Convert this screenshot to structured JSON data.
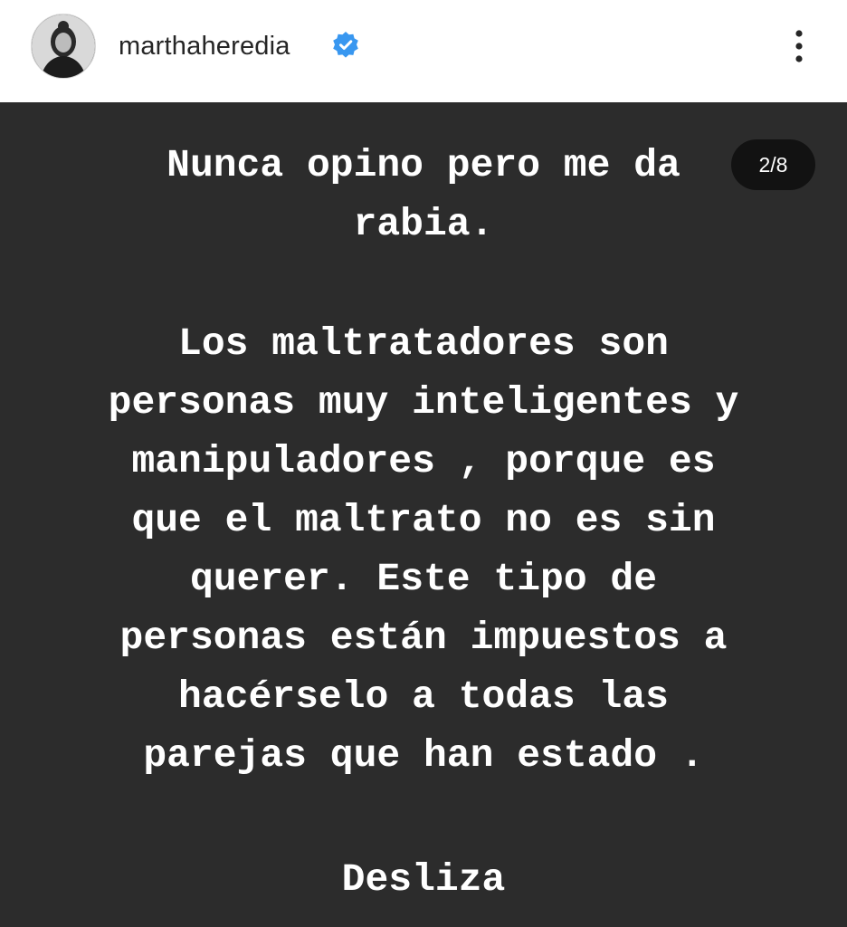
{
  "header": {
    "username": "marthaheredia",
    "verified": true,
    "avatar_icon": "profile-photo",
    "more_icon": "more-vertical-icon"
  },
  "post": {
    "counter": "2/8",
    "paragraph1": "Nunca opino pero me da\nrabia.",
    "paragraph2": "Los maltratadores son\npersonas muy inteligentes y\nmanipuladores , porque es\nque el maltrato no es sin\nquerer. Este tipo de\npersonas están impuestos a\nhacérselo a todas las\nparejas que han estado .",
    "paragraph3": "Desliza"
  },
  "colors": {
    "post_background": "#2c2c2c",
    "verified_badge": "#3897f0",
    "counter_background": "#121212"
  }
}
